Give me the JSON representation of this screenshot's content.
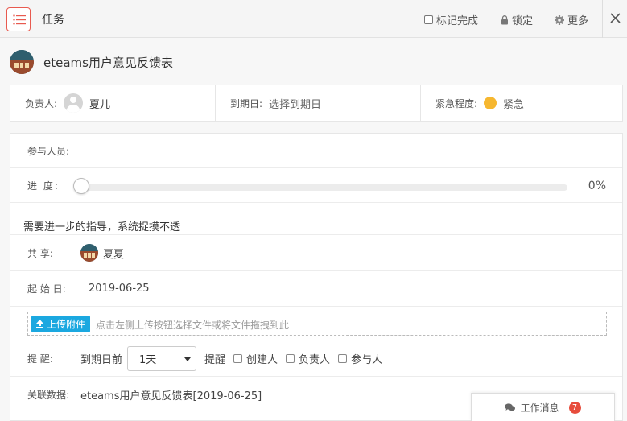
{
  "header": {
    "title": "任务",
    "mark_complete_label": "标记完成",
    "lock_label": "锁定",
    "more_label": "更多"
  },
  "task": {
    "title": "eteams用户意见反馈表"
  },
  "summary": {
    "owner_label": "负责人:",
    "owner_name": "夏儿",
    "due_label": "到期日:",
    "due_placeholder": "选择到期日",
    "urgency_label": "紧急程度:",
    "urgency_value": "紧急",
    "urgency_color": "#f6b730"
  },
  "details": {
    "participants_label": "参与人员:",
    "progress_label": "进 度:",
    "progress_value": 0,
    "progress_text": "0%",
    "description": "需要进一步的指导，系统捉摸不透",
    "share_label": "共 享:",
    "share_user": "夏夏",
    "start_label": "起 始 日:",
    "start_date": "2019-06-25",
    "upload_button": "上传附件",
    "upload_hint": "点击左侧上传按钮选择文件或将文件拖拽到此",
    "reminder_label": "提 醒:",
    "reminder_prefix": "到期日前",
    "reminder_option": "1天",
    "reminder_word": "提醒",
    "reminder_creator": "创建人",
    "reminder_owner": "负责人",
    "reminder_participant": "参与人",
    "related_label": "关联数据:",
    "related_value": "eteams用户意见反馈表[2019-06-25]"
  },
  "messages": {
    "label": "工作消息",
    "count": "7"
  },
  "colors": {
    "accent_red": "#e85a4f",
    "upload_blue": "#1ba8e0",
    "badge_red": "#e74c3c"
  }
}
